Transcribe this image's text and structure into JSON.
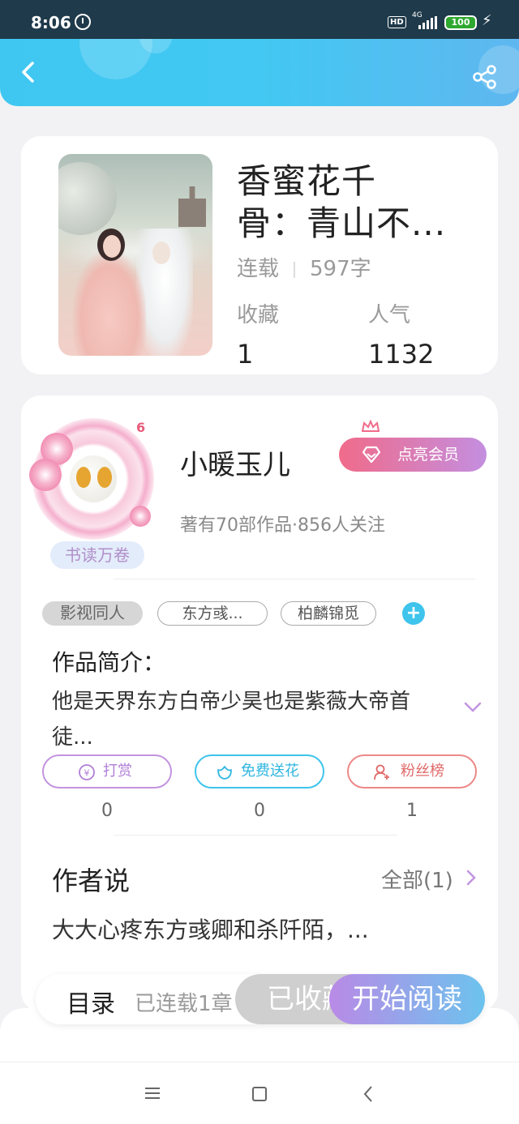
{
  "status_bar": {
    "time": "8:06",
    "hd": "HD",
    "network": "4G",
    "battery": "100"
  },
  "book": {
    "title_line1": "香蜜花千",
    "title_line2": "骨：青山不...",
    "status": "连载",
    "word_count": "597字",
    "favorites_label": "收藏",
    "favorites_value": "1",
    "popularity_label": "人气",
    "popularity_value": "1132"
  },
  "author": {
    "level": "6",
    "badge": "书读万卷",
    "name": "小暖玉儿",
    "vip_button": "点亮会员",
    "info": "著有70部作品·856人关注"
  },
  "tags": [
    "影视同人",
    "东方彧...",
    "柏麟锦觅"
  ],
  "intro": {
    "title": "作品简介：",
    "text": "他是天界东方白帝少昊也是紫薇大帝首徒..."
  },
  "actions": [
    {
      "label": "打赏",
      "count": "0",
      "color": "#c394e0"
    },
    {
      "label": "免费送花",
      "count": "0",
      "color": "#3fc4ec"
    },
    {
      "label": "粉丝榜",
      "count": "1",
      "color": "#ee8888"
    }
  ],
  "author_says": {
    "title": "作者说",
    "all_link": "全部(1)",
    "text": "大大心疼东方彧卿和杀阡陌，..."
  },
  "bottom_bar": {
    "toc": "目录",
    "serial": "已连载1章",
    "saved_button": "已收藏",
    "read_button": "开始阅读"
  }
}
